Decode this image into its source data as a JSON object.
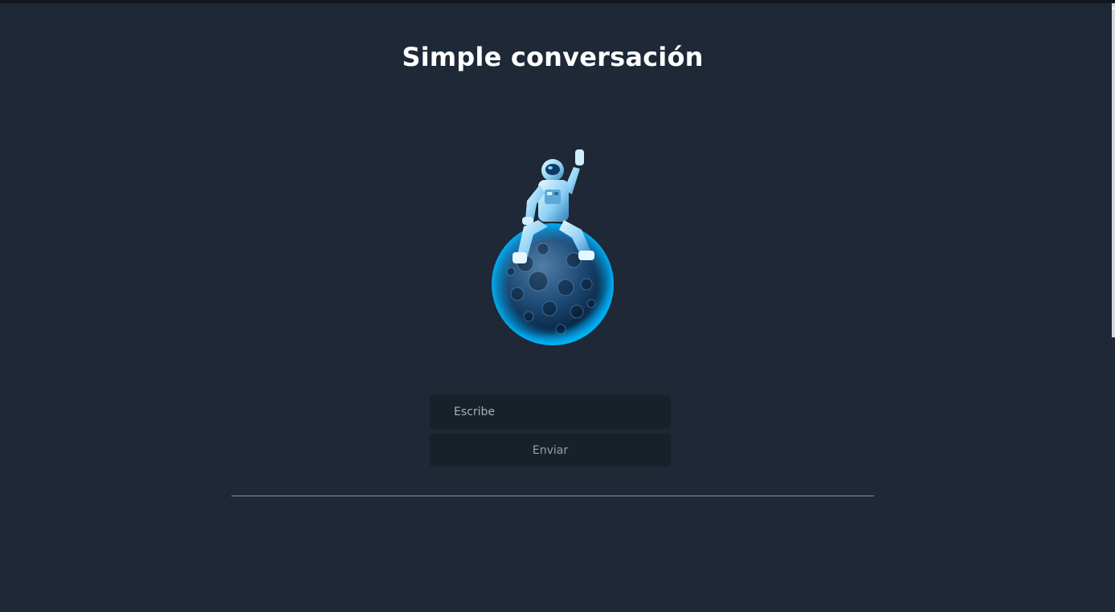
{
  "page": {
    "title": "Simple conversación"
  },
  "hero": {
    "icon": "astronaut-on-moon-icon"
  },
  "chat": {
    "input_placeholder": "Escribe",
    "input_value": "",
    "send_label": "Enviar"
  },
  "colors": {
    "background": "#1e2836",
    "field": "#18202a",
    "title": "#ffffff",
    "accent": "#1ea7ff"
  }
}
